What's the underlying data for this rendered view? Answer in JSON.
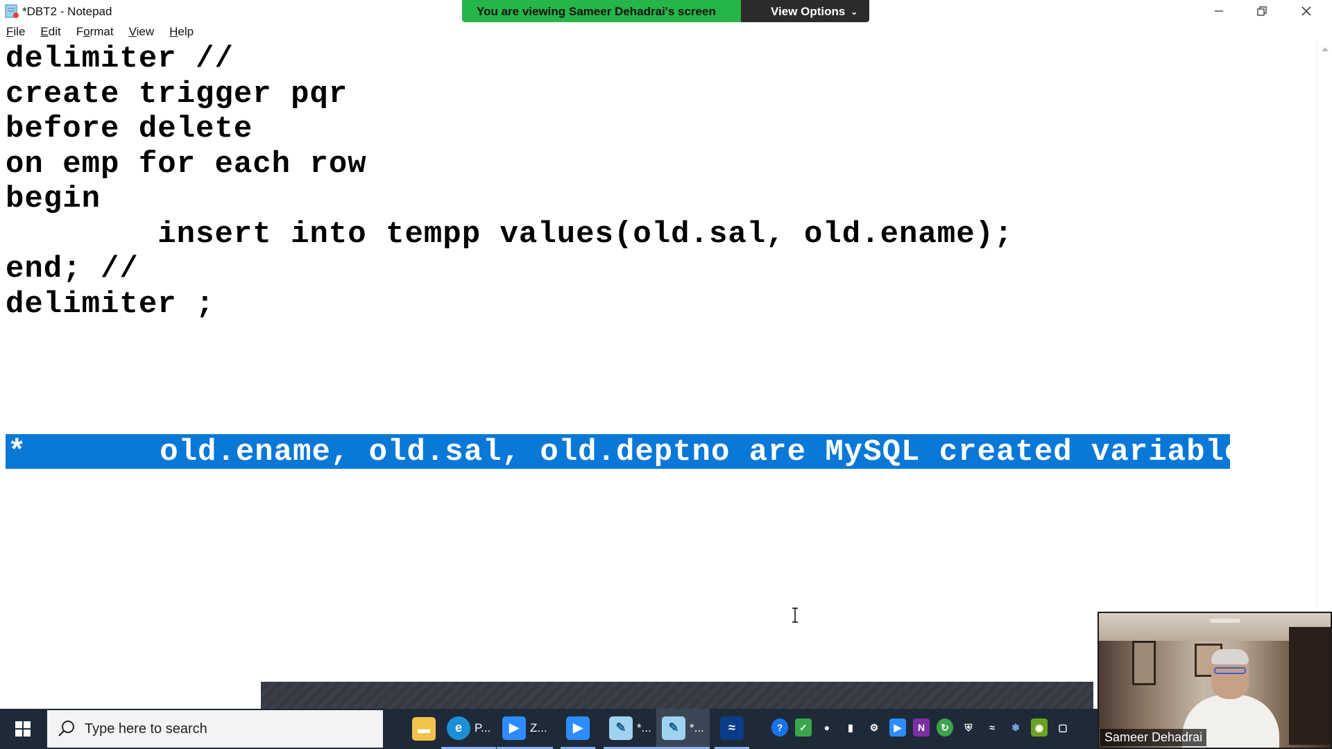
{
  "window": {
    "title": "*DBT2 - Notepad",
    "controls": {
      "minimize": "minimize",
      "restore": "restore",
      "close": "close"
    }
  },
  "share_banner": {
    "viewing_text": "You are viewing Sameer Dehadrai's screen",
    "view_options_label": "View Options"
  },
  "menu": {
    "items": [
      {
        "label": "File",
        "underline": "F",
        "rest": "ile"
      },
      {
        "label": "Edit",
        "underline": "E",
        "rest": "dit"
      },
      {
        "label": "Format",
        "underline": "o",
        "pre": "F",
        "rest": "rmat"
      },
      {
        "label": "View",
        "underline": "V",
        "rest": "iew"
      },
      {
        "label": "Help",
        "underline": "H",
        "rest": "elp"
      }
    ]
  },
  "editor": {
    "lines": [
      "delimiter //",
      "create trigger pqr",
      "before delete",
      "on emp for each row",
      "begin",
      "        insert into tempp values(old.sal, old.ename);",
      "end; //",
      "delimiter ;"
    ],
    "selected_line": "*       old.ename, old.sal, old.deptno are MySQL created variables"
  },
  "taskbar": {
    "search_placeholder": "Type here to search",
    "apps": [
      {
        "icon": "file-explorer-icon",
        "label": ""
      },
      {
        "icon": "edge-icon",
        "label": "P..."
      },
      {
        "icon": "zoom-icon",
        "label": "Z..."
      },
      {
        "icon": "zoom-meeting-icon",
        "label": ""
      },
      {
        "icon": "notepad-icon",
        "label": "*..."
      },
      {
        "icon": "notepad-icon",
        "label": "*..."
      },
      {
        "icon": "whiteboard-icon",
        "label": ""
      }
    ],
    "tray_icons": [
      "help-icon",
      "check-icon",
      "microphone-icon",
      "battery-icon",
      "steam-icon",
      "zoom-tray-icon",
      "onenote-icon",
      "update-icon",
      "shield-icon",
      "wifi-icon",
      "bluetooth-icon",
      "nvidia-icon",
      "app-tray-icon",
      "notepad-tray-icon"
    ]
  },
  "webcam": {
    "participant_name": "Sameer Dehadrai"
  },
  "colors": {
    "selection": "#0a78d7",
    "banner_green": "#25b548",
    "taskbar": "#1f2a38"
  }
}
